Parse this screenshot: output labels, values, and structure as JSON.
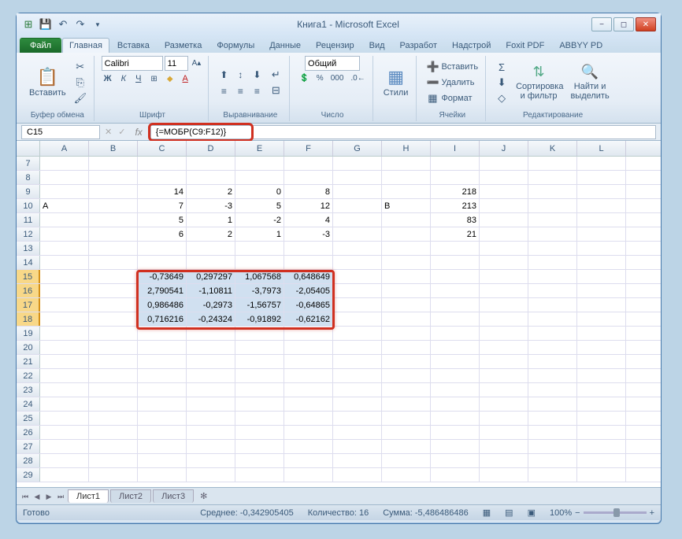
{
  "title": "Книга1  -  Microsoft Excel",
  "qat": {
    "save": "💾",
    "undo": "↶",
    "redo": "↷"
  },
  "tabs": {
    "file": "Файл",
    "home": "Главная",
    "insert": "Вставка",
    "layout": "Разметка",
    "formulas": "Формулы",
    "data": "Данные",
    "review": "Рецензир",
    "view": "Вид",
    "dev": "Разработ",
    "addin": "Надстрой",
    "foxit": "Foxit PDF",
    "abbyy": "ABBYY PD"
  },
  "ribbon": {
    "clipboard": {
      "paste": "Вставить",
      "name": "Буфер обмена"
    },
    "font": {
      "family": "Calibri",
      "size": "11",
      "name": "Шрифт"
    },
    "align": {
      "wrap": "≡",
      "merge": "⊞",
      "name": "Выравнивание"
    },
    "number": {
      "fmt": "Общий",
      "name": "Число"
    },
    "styles": {
      "btn": "Стили"
    },
    "cells": {
      "insert": "Вставить",
      "delete": "Удалить",
      "format": "Формат",
      "name": "Ячейки"
    },
    "edit": {
      "sort": "Сортировка и фильтр",
      "find": "Найти и выделить",
      "name": "Редактирование"
    }
  },
  "namebox": "C15",
  "formula": "{=МОБР(C9:F12)}",
  "cols": [
    "A",
    "B",
    "C",
    "D",
    "E",
    "F",
    "G",
    "H",
    "I",
    "J",
    "K",
    "L"
  ],
  "rownums": [
    "7",
    "8",
    "9",
    "10",
    "11",
    "12",
    "13",
    "14",
    "15",
    "16",
    "17",
    "18",
    "19",
    "20",
    "21",
    "22",
    "23",
    "24",
    "25",
    "26",
    "27",
    "28",
    "29"
  ],
  "cells": {
    "9": {
      "C": "14",
      "D": "2",
      "E": "0",
      "F": "8",
      "I": "218"
    },
    "10": {
      "A": "A",
      "C": "7",
      "D": "-3",
      "E": "5",
      "F": "12",
      "H": "B",
      "I": "213"
    },
    "11": {
      "C": "5",
      "D": "1",
      "E": "-2",
      "F": "4",
      "I": "83"
    },
    "12": {
      "C": "6",
      "D": "2",
      "E": "1",
      "F": "-3",
      "I": "21"
    },
    "15": {
      "C": "-0,73649",
      "D": "0,297297",
      "E": "1,067568",
      "F": "0,648649"
    },
    "16": {
      "C": "2,790541",
      "D": "-1,10811",
      "E": "-3,7973",
      "F": "-2,05405"
    },
    "17": {
      "C": "0,986486",
      "D": "-0,2973",
      "E": "-1,56757",
      "F": "-0,64865"
    },
    "18": {
      "C": "0,716216",
      "D": "-0,24324",
      "E": "-0,91892",
      "F": "-0,62162"
    }
  },
  "selrange": {
    "r1": "15",
    "r2": "18",
    "c1": "C",
    "c2": "F"
  },
  "sheets": {
    "s1": "Лист1",
    "s2": "Лист2",
    "s3": "Лист3"
  },
  "status": {
    "ready": "Готово",
    "avg": "Среднее: -0,342905405",
    "count": "Количество: 16",
    "sum": "Сумма: -5,486486486",
    "zoom": "100%"
  }
}
